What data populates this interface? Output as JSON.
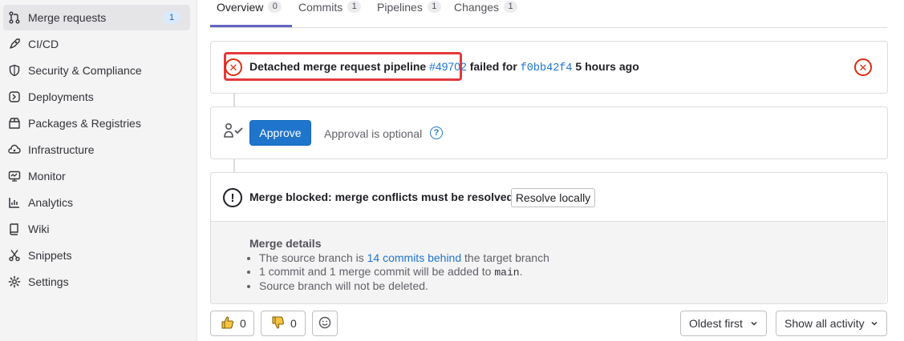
{
  "sidebar": {
    "items": [
      {
        "label": "Merge requests",
        "icon": "merge-request-icon",
        "badge": "1",
        "active": true
      },
      {
        "label": "CI/CD",
        "icon": "rocket-icon"
      },
      {
        "label": "Security & Compliance",
        "icon": "shield-icon"
      },
      {
        "label": "Deployments",
        "icon": "deployments-icon"
      },
      {
        "label": "Packages & Registries",
        "icon": "package-icon"
      },
      {
        "label": "Infrastructure",
        "icon": "cloud-gear-icon"
      },
      {
        "label": "Monitor",
        "icon": "monitor-icon"
      },
      {
        "label": "Analytics",
        "icon": "chart-icon"
      },
      {
        "label": "Wiki",
        "icon": "book-icon"
      },
      {
        "label": "Snippets",
        "icon": "scissors-icon"
      },
      {
        "label": "Settings",
        "icon": "gear-icon"
      }
    ]
  },
  "tabs": [
    {
      "label": "Overview",
      "count": "0"
    },
    {
      "label": "Commits",
      "count": "1"
    },
    {
      "label": "Pipelines",
      "count": "1"
    },
    {
      "label": "Changes",
      "count": "1"
    }
  ],
  "pipeline": {
    "prefix": "Detached merge request pipeline",
    "id": "#49702",
    "failed_for": "failed for",
    "sha": "f0bb42f4",
    "time": "5 hours ago"
  },
  "approval": {
    "button": "Approve",
    "text": "Approval is optional"
  },
  "merge": {
    "blocked": "Merge blocked: merge conflicts must be resolved.",
    "resolve_button": "Resolve locally",
    "details_title": "Merge details",
    "line1_prefix": "The source branch is",
    "line1_link": "14 commits behind",
    "line1_suffix": "the target branch",
    "line2_prefix": "1 commit and 1 merge commit will be added to",
    "line2_code": "main",
    "line2_suffix": ".",
    "line3": "Source branch will not be deleted."
  },
  "reactions": {
    "thumbs_up": "0",
    "thumbs_down": "0"
  },
  "sorting": {
    "order": "Oldest first",
    "filter": "Show all activity"
  },
  "colors": {
    "primary": "#1f75cb",
    "danger": "#dd2b0e",
    "highlight": "#e5383b",
    "tab_indicator": "#6366c1"
  }
}
